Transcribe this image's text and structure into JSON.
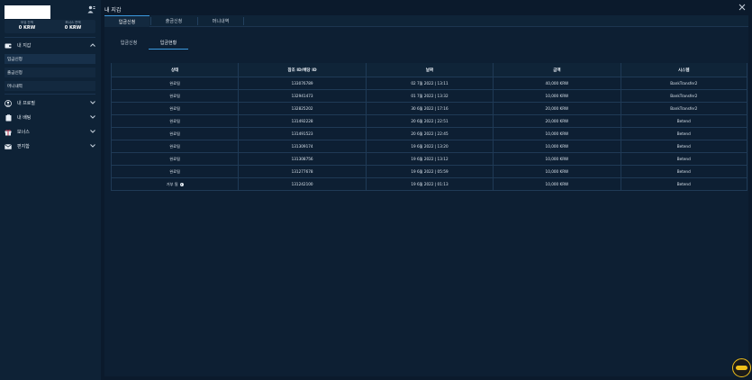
{
  "sidebar": {
    "balances": [
      {
        "label": "보유 잔액",
        "value": "0 KRW"
      },
      {
        "label": "보너스 잔액",
        "value": "0 KRW"
      }
    ],
    "wallet": {
      "label": "내 지갑"
    },
    "sub_items": [
      {
        "label": "입금신청"
      },
      {
        "label": "출금신청"
      },
      {
        "label": "머니내역"
      }
    ],
    "sections": [
      {
        "label": "내 프로필",
        "icon": "user-circle-icon"
      },
      {
        "label": "내 배팅",
        "icon": "clipboard-icon"
      },
      {
        "label": "보너스",
        "icon": "gift-icon"
      },
      {
        "label": "편지함",
        "icon": "envelope-icon"
      }
    ]
  },
  "main": {
    "title": "내 지갑",
    "tabs": [
      {
        "label": "입금신청",
        "active": true
      },
      {
        "label": "출금신청",
        "active": false
      },
      {
        "label": "머니내역",
        "active": false
      }
    ],
    "subtabs": [
      {
        "label": "입금신청",
        "active": false
      },
      {
        "label": "입금현황",
        "active": true
      }
    ],
    "table": {
      "headers": [
        "상태",
        "참조 ID/배당 ID",
        "날짜",
        "금액",
        "시스템"
      ],
      "rows": [
        [
          "완료됨",
          "133076789",
          "02 7월 2022 | 13:11",
          "40,000 KRW",
          "BankTransfer2"
        ],
        [
          "완료됨",
          "132941473",
          "01 7월 2022 | 13:32",
          "10,000 KRW",
          "BankTransfer2"
        ],
        [
          "완료됨",
          "132825202",
          "30 6월 2022 | 17:16",
          "20,000 KRW",
          "BankTransfer2"
        ],
        [
          "완료됨",
          "131492228",
          "20 6월 2022 | 22:51",
          "20,000 KRW",
          "Betend"
        ],
        [
          "완료됨",
          "131491523",
          "20 6월 2022 | 22:45",
          "10,000 KRW",
          "Betend"
        ],
        [
          "완료됨",
          "131309174",
          "19 6월 2022 | 13:20",
          "10,000 KRW",
          "Betend"
        ],
        [
          "완료됨",
          "131308756",
          "19 6월 2022 | 13:12",
          "10,000 KRW",
          "Betend"
        ],
        [
          "완료됨",
          "131277678",
          "19 6월 2022 | 05:59",
          "10,000 KRW",
          "Betend"
        ],
        [
          "거부 됨",
          "131242100",
          "19 6월 2022 | 01:13",
          "10,000 KRW",
          "Betend"
        ]
      ]
    }
  },
  "colors": {
    "accent": "#3b9ae0",
    "background": "#0b1a2c",
    "sidebar": "#0e2236",
    "chat": "#f0c01a"
  }
}
